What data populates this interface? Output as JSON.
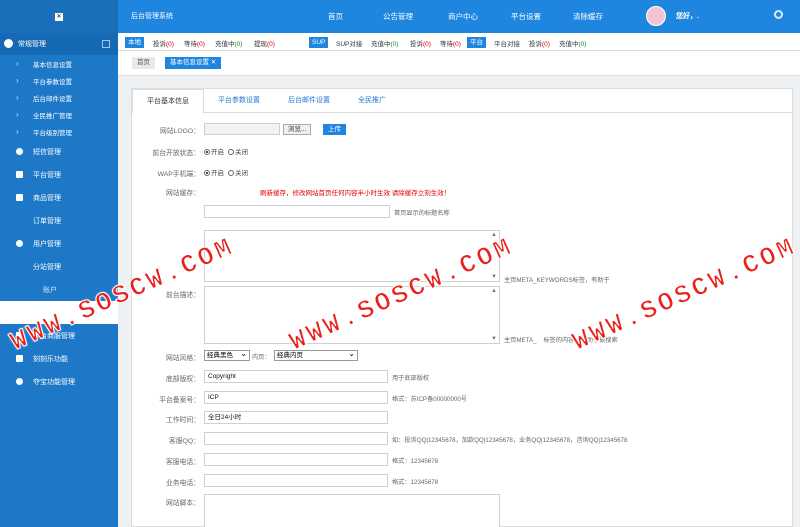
{
  "topbar": {
    "title": "后台管理系统",
    "nav": [
      "首页",
      "公告管理",
      "商户中心",
      "平台设置",
      "清除缓存"
    ],
    "greeting": "您好，."
  },
  "sidebar": {
    "section": "常规管理",
    "subitems": [
      "基本信息设置",
      "平台参数设置",
      "后台邮件设置",
      "全民推广管理",
      "平台级别管理"
    ],
    "items": [
      "短信管理",
      "平台管理",
      "商品管理",
      "订单管理",
      "用户管理",
      "分站管理",
      "",
      "平台商服管理",
      "刻刻乐功能",
      "夺宝功能管理"
    ],
    "hidden_item": "账户"
  },
  "stats": {
    "tag_local": "本地",
    "local": [
      {
        "label": "投诉",
        "value": "(0)",
        "color": "red"
      },
      {
        "label": "等待",
        "value": "(0)",
        "color": "red"
      },
      {
        "label": "充值中",
        "value": "(0)",
        "color": "green"
      },
      {
        "label": "提现",
        "value": "(0)",
        "color": "red"
      }
    ],
    "tag_sup": "SUP",
    "sup": [
      {
        "label": "SUP对接",
        "value": "",
        "color": ""
      },
      {
        "label": "充值中",
        "value": "(0)",
        "color": "green"
      },
      {
        "label": "投诉",
        "value": "(0)",
        "color": "red"
      },
      {
        "label": "等待",
        "value": "(0)",
        "color": "red"
      }
    ],
    "tag_platform": "平台",
    "platform": [
      {
        "label": "平台对接",
        "value": "",
        "color": ""
      },
      {
        "label": "投诉",
        "value": "(0)",
        "color": "red"
      },
      {
        "label": "充值中",
        "value": "(0)",
        "color": "green"
      }
    ]
  },
  "crumbs": {
    "home": "首页",
    "active": "基本信息设置 ✕"
  },
  "tabs": [
    "平台基本信息",
    "平台参数设置",
    "后台邮件设置",
    "全民推广"
  ],
  "form": {
    "logo_label": "网站LOGO：",
    "browse": "浏览...",
    "upload": "上传",
    "frontend_label": "前台开放状态：",
    "wap_label": "WAP手机端：",
    "radio_on": "开启",
    "radio_off": "关闭",
    "cache_label": "网站缓存：",
    "cache_notice": "刷新缓存，修改网站首页任何内容半小时生效 请除缓存立刻生效！",
    "title_hint": "首页显示的标题名称",
    "keywords_hint": "主页META_KEYWORDS标签，有助于",
    "desc_label": "前台描述：",
    "desc_hint": "主页META_",
    "desc_hint2": "标签的内容，有助于被搜索",
    "style_label": "网站风格：",
    "style_value": "经典黑色",
    "inner_label": "内页：",
    "inner_value": "经典内页",
    "copyright_label": "底部版权：",
    "copyright_value": "Copyright",
    "copyright_hint": "用于底部版权",
    "icp_label": "平台备案号：",
    "icp_value": "ICP",
    "icp_hint": "格式：苏ICP备00000000号",
    "worktime_label": "工作时间：",
    "worktime_value": "全日24小时",
    "qq_label": "客服QQ：",
    "qq_hint": "如：投诉QQ|12345678，加款QQ|12345678，业务QQ|12345678，咨询QQ|12345678",
    "tel_label": "客服电话：",
    "tel_hint": "格式：12345678",
    "biz_tel_label": "业务电话：",
    "biz_tel_hint": "格式：12345678",
    "script_label": "网站脚本："
  },
  "watermark": "WWW.SOSCW.COM",
  "colors": {
    "primary": "#1f86e0",
    "sidebar": "#1d78c8",
    "red": "#e00000",
    "green": "#1a8d1a"
  }
}
